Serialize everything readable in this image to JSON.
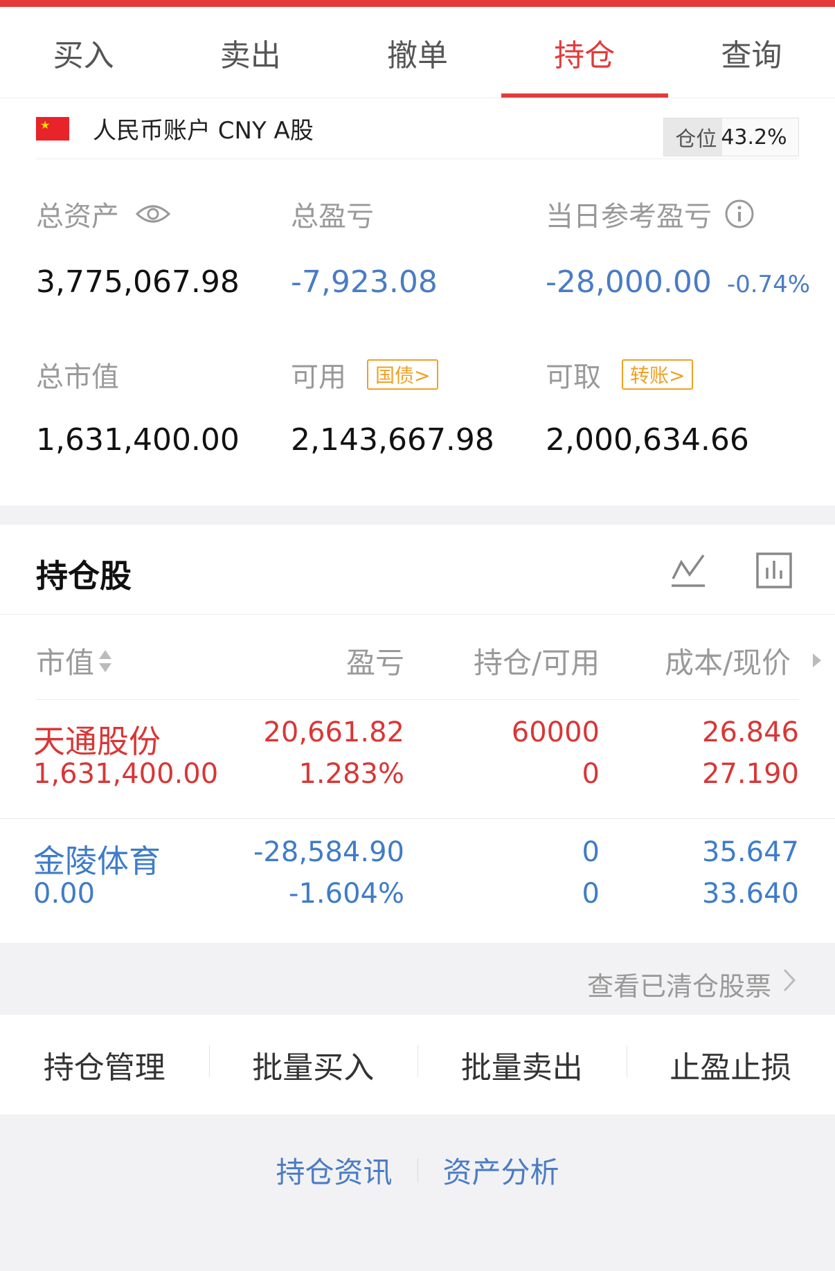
{
  "tabs": [
    {
      "label": "买入"
    },
    {
      "label": "卖出"
    },
    {
      "label": "撤单"
    },
    {
      "label": "持仓",
      "active": true
    },
    {
      "label": "查询"
    }
  ],
  "account": {
    "name": "人民币账户 CNY A股",
    "flag": "cn-flag-icon",
    "position_label": "仓位",
    "position_value": "43.2%",
    "position_fraction": 0.432
  },
  "summary": {
    "total_assets_label": "总资产",
    "total_assets": "3,775,067.98",
    "total_pl_label": "总盈亏",
    "total_pl": "-7,923.08",
    "daily_pl_label": "当日参考盈亏",
    "daily_pl": "-28,000.00",
    "daily_pl_pct": "-0.74%",
    "market_value_label": "总市值",
    "market_value": "1,631,400.00",
    "available_label": "可用",
    "available_tag": "国债>",
    "available": "2,143,667.98",
    "withdrawable_label": "可取",
    "withdrawable_tag": "转账>",
    "withdrawable": "2,000,634.66"
  },
  "holdings": {
    "title": "持仓股",
    "columns": [
      "市值",
      "盈亏",
      "持仓/可用",
      "成本/现价"
    ],
    "rows": [
      {
        "name": "天通股份",
        "market_value": "1,631,400.00",
        "pl": "20,661.82",
        "pl_pct": "1.283%",
        "position": "60000",
        "available": "0",
        "cost": "26.846",
        "price": "27.190",
        "color": "#d93636"
      },
      {
        "name": "金陵体育",
        "market_value": "0.00",
        "pl": "-28,584.90",
        "pl_pct": "-1.604%",
        "position": "0",
        "available": "0",
        "cost": "35.647",
        "price": "33.640",
        "color": "#3f7cc8"
      }
    ]
  },
  "view_cleared": "查看已清仓股票",
  "actions": [
    "持仓管理",
    "批量买入",
    "批量卖出",
    "止盈止损"
  ],
  "links": [
    "持仓资讯",
    "资产分析"
  ],
  "colors": {
    "accent": "#e23b3b",
    "loss": "#4a7cc4",
    "tag": "#f0a024"
  }
}
